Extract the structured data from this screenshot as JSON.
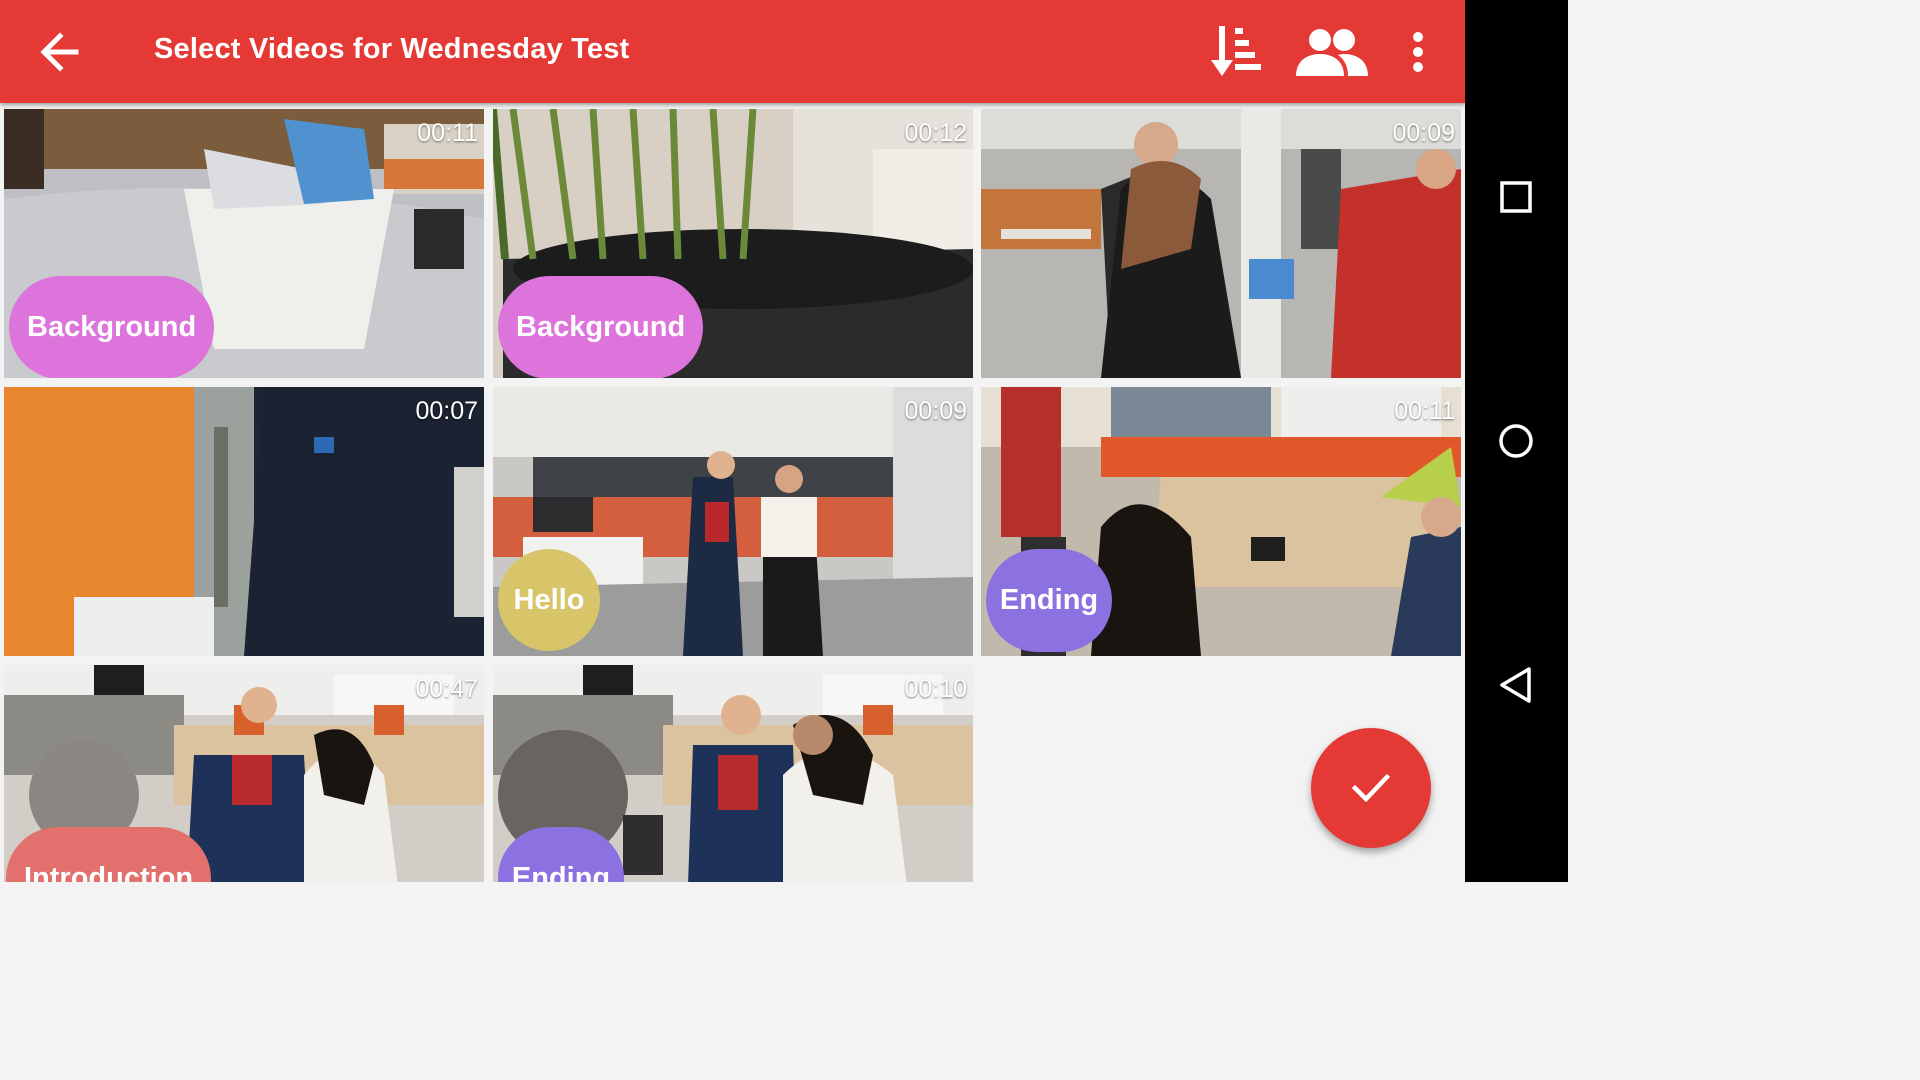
{
  "appbar": {
    "title": "Select Videos for Wednesday Test",
    "color": "#e53935",
    "icons": {
      "back": "arrow-back-icon",
      "sort": "sort-icon",
      "people": "people-icon",
      "more": "more-vert-icon"
    }
  },
  "videos": [
    {
      "duration": "00:11",
      "tag": "Background",
      "tag_color": "#dd74dc",
      "scene": "Yogurt cup on table"
    },
    {
      "duration": "00:12",
      "tag": "Background",
      "tag_color": "#dd74dc",
      "scene": "Potted plant"
    },
    {
      "duration": "00:09",
      "tag": "",
      "tag_color": "",
      "scene": "People in office with tablet"
    },
    {
      "duration": "00:07",
      "tag": "",
      "tag_color": "",
      "scene": "Blurry close-up"
    },
    {
      "duration": "00:09",
      "tag": "Hello",
      "tag_color": "#d8c56a",
      "scene": "Two women walking in office"
    },
    {
      "duration": "00:11",
      "tag": "Ending",
      "tag_color": "#8b72e0",
      "scene": "Meeting room table"
    },
    {
      "duration": "00:47",
      "tag": "Introduction",
      "tag_color": "#e2706c",
      "scene": "Group conversation"
    },
    {
      "duration": "00:10",
      "tag": "Ending",
      "tag_color": "#8b72e0",
      "scene": "Group conversation"
    }
  ],
  "fab": {
    "icon": "check-icon",
    "color": "#e53935"
  },
  "navbar": {
    "icons": [
      "recents-square-icon",
      "home-circle-icon",
      "back-triangle-icon"
    ]
  }
}
